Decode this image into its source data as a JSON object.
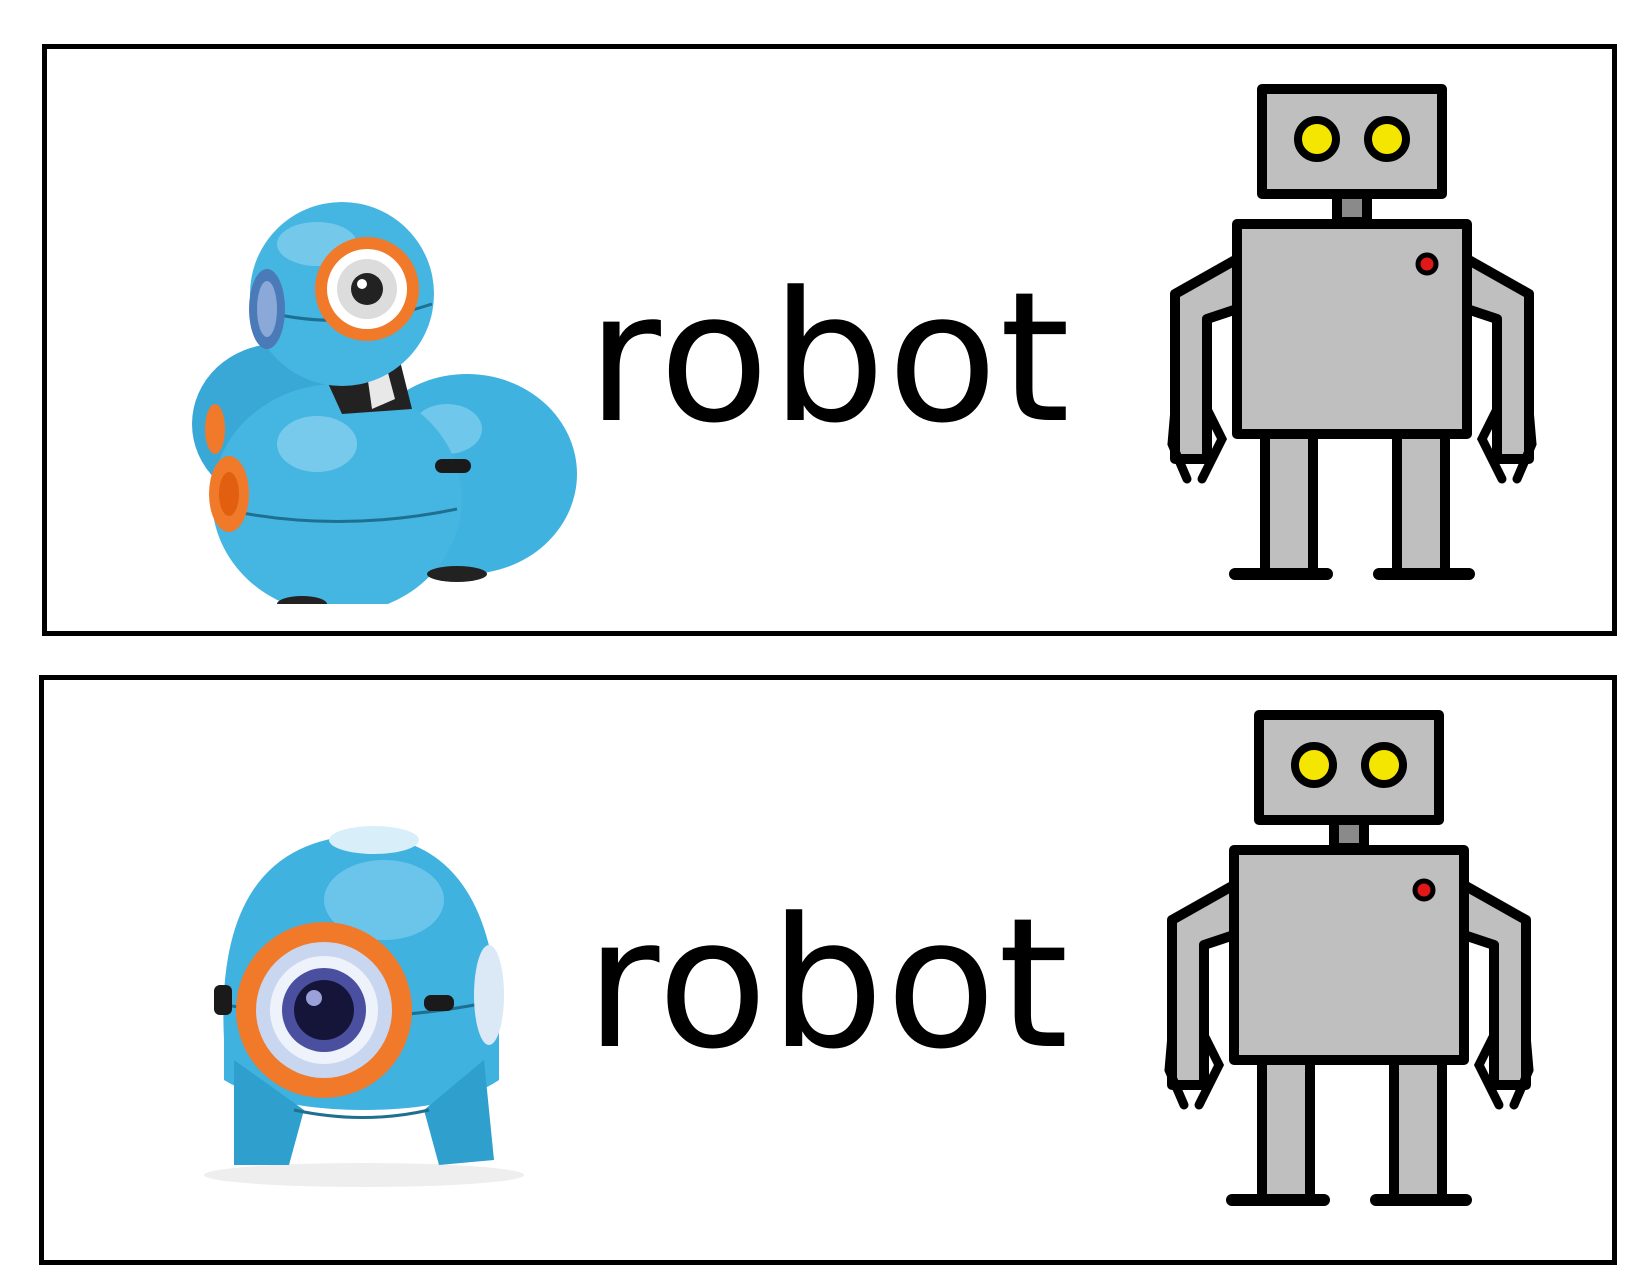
{
  "cards": [
    {
      "word": "robot",
      "photo_icon": "dash-robot-photo",
      "clipart_icon": "robot-clipart-icon"
    },
    {
      "word": "robot",
      "photo_icon": "dot-robot-photo",
      "clipart_icon": "robot-clipart-icon"
    }
  ],
  "colors": {
    "robot_blue": "#3fb2e0",
    "robot_orange": "#f07a2a",
    "clipart_gray": "#c0bfc0",
    "clipart_eye_yellow": "#f4e600",
    "clipart_button_red": "#e01818"
  }
}
